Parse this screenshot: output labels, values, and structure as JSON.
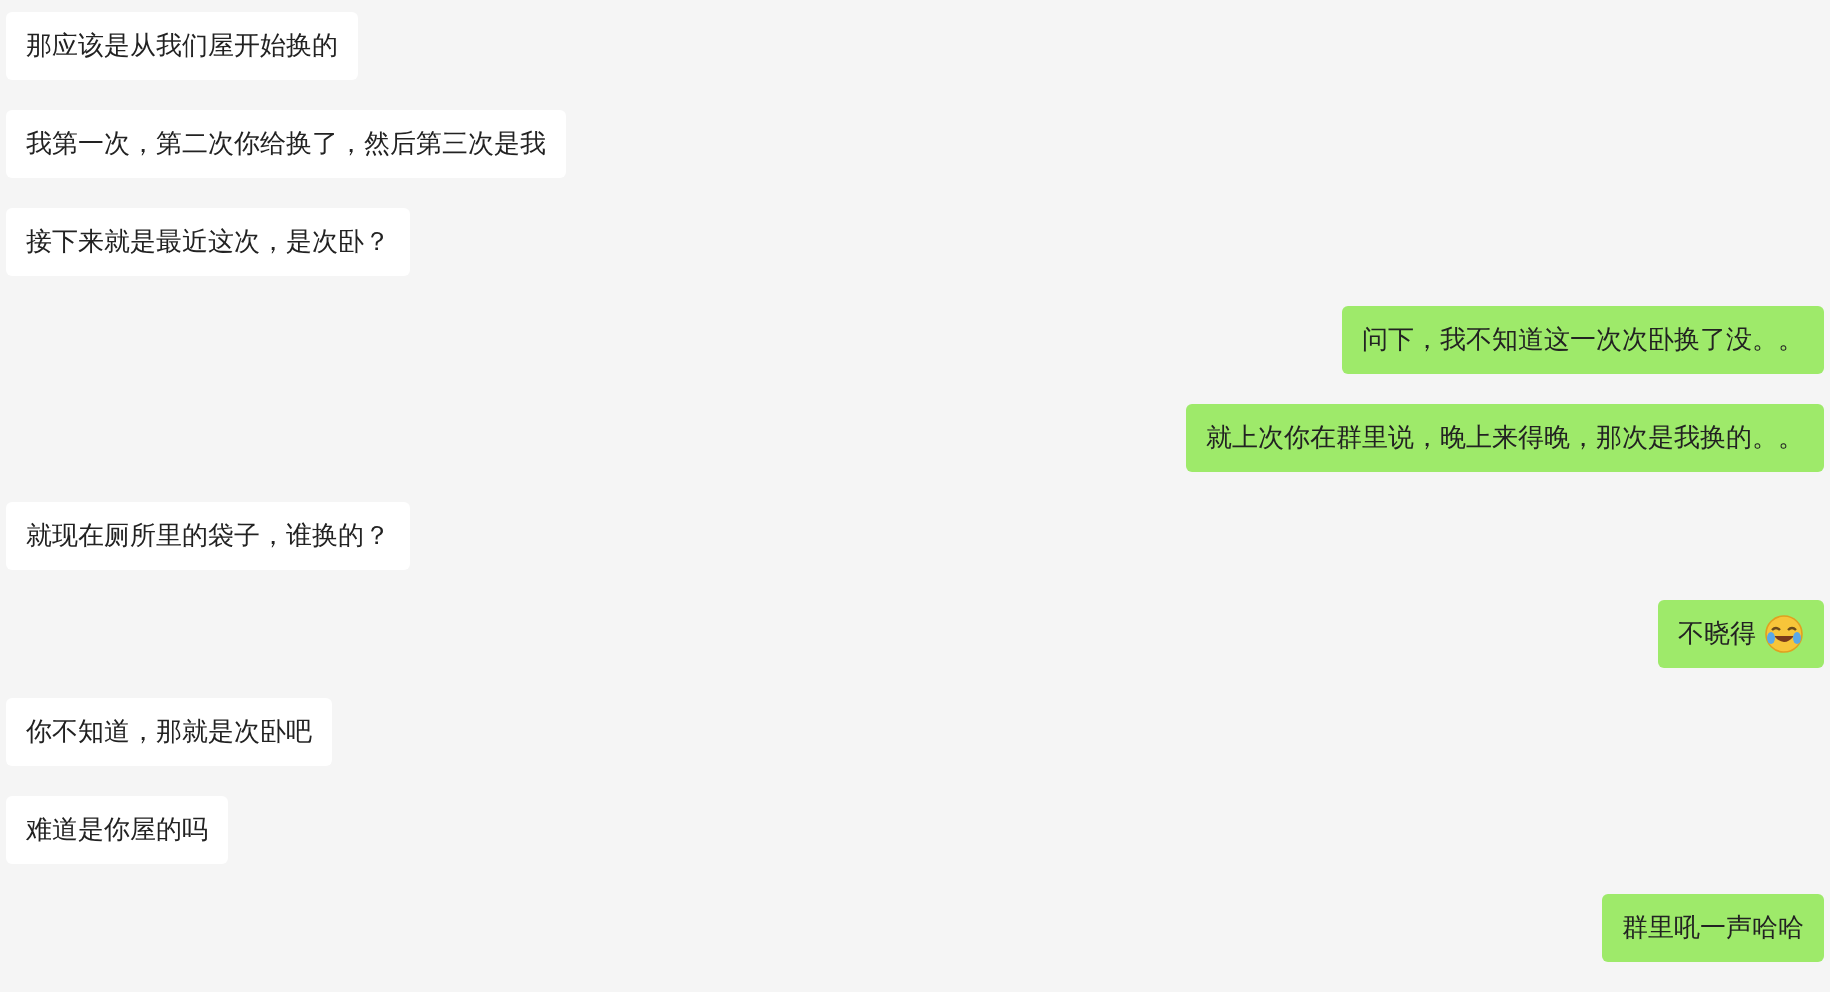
{
  "messages": [
    {
      "outgoing": false,
      "text": "那应该是从我们屋开始换的"
    },
    {
      "outgoing": false,
      "text": "我第一次，第二次你给换了，然后第三次是我"
    },
    {
      "outgoing": false,
      "text": "接下来就是最近这次，是次卧？"
    },
    {
      "outgoing": true,
      "text": "问下，我不知道这一次次卧换了没。。"
    },
    {
      "outgoing": true,
      "text": "就上次你在群里说，晚上来得晚，那次是我换的。。"
    },
    {
      "outgoing": false,
      "text": "就现在厕所里的袋子，谁换的？"
    },
    {
      "outgoing": true,
      "text": "不晓得",
      "emoji": true
    },
    {
      "outgoing": false,
      "text": "你不知道，那就是次卧吧"
    },
    {
      "outgoing": false,
      "text": "难道是你屋的吗"
    },
    {
      "outgoing": true,
      "text": "群里吼一声哈哈"
    }
  ]
}
